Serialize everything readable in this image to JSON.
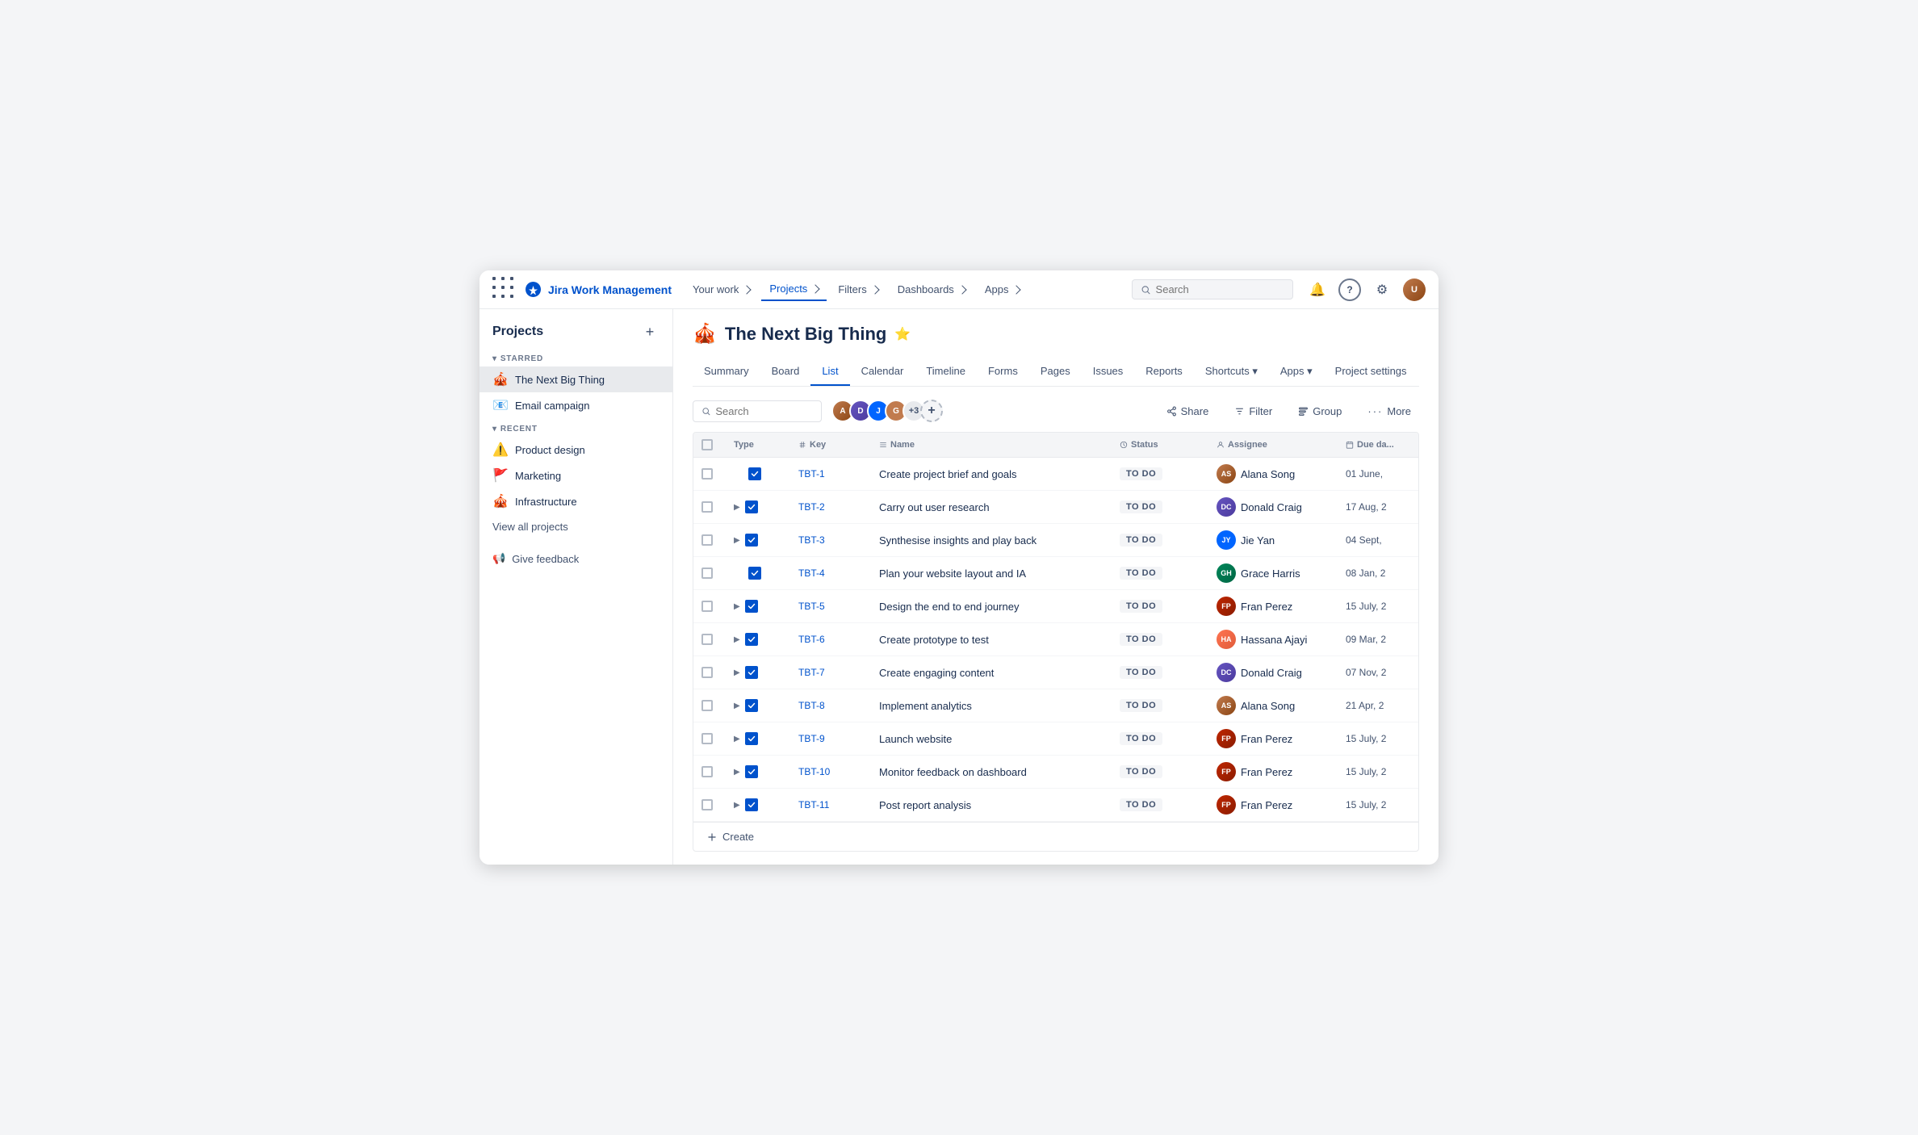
{
  "app": {
    "name": "Jira Work Management"
  },
  "nav": {
    "links": [
      {
        "id": "your-work",
        "label": "Your work",
        "active": false
      },
      {
        "id": "projects",
        "label": "Projects",
        "active": true
      },
      {
        "id": "filters",
        "label": "Filters",
        "active": false
      },
      {
        "id": "dashboards",
        "label": "Dashboards",
        "active": false
      },
      {
        "id": "apps",
        "label": "Apps",
        "active": false
      }
    ],
    "search_placeholder": "Search",
    "icons": {
      "notification": "🔔",
      "help": "?",
      "settings": "⚙"
    }
  },
  "sidebar": {
    "title": "Projects",
    "add_label": "+",
    "starred_label": "STARRED",
    "recent_label": "RECENT",
    "starred_items": [
      {
        "id": "next-big-thing",
        "emoji": "🎪",
        "label": "The Next Big Thing",
        "active": true
      },
      {
        "id": "email-campaign",
        "emoji": "📧",
        "label": "Email campaign",
        "active": false
      }
    ],
    "recent_items": [
      {
        "id": "product-design",
        "emoji": "⚠️",
        "label": "Product design",
        "active": false
      },
      {
        "id": "marketing",
        "emoji": "🚩",
        "label": "Marketing",
        "active": false
      },
      {
        "id": "infrastructure",
        "emoji": "🎪",
        "label": "Infrastructure",
        "active": false
      }
    ],
    "view_all": "View all projects",
    "feedback": "Give feedback"
  },
  "project": {
    "icon": "🎪",
    "name": "The Next Big Thing",
    "tabs": [
      {
        "id": "summary",
        "label": "Summary"
      },
      {
        "id": "board",
        "label": "Board"
      },
      {
        "id": "list",
        "label": "List",
        "active": true
      },
      {
        "id": "calendar",
        "label": "Calendar"
      },
      {
        "id": "timeline",
        "label": "Timeline"
      },
      {
        "id": "forms",
        "label": "Forms"
      },
      {
        "id": "pages",
        "label": "Pages"
      },
      {
        "id": "issues",
        "label": "Issues"
      },
      {
        "id": "reports",
        "label": "Reports"
      },
      {
        "id": "shortcuts",
        "label": "Shortcuts"
      },
      {
        "id": "apps",
        "label": "Apps"
      },
      {
        "id": "project-settings",
        "label": "Project settings"
      }
    ]
  },
  "toolbar": {
    "search_placeholder": "Search",
    "avatar_count": "+3",
    "share_label": "Share",
    "filter_label": "Filter",
    "group_label": "Group",
    "more_label": "More"
  },
  "table": {
    "columns": [
      "Type",
      "Key",
      "Name",
      "Status",
      "Assignee",
      "Due da..."
    ],
    "rows": [
      {
        "key": "TBT-1",
        "name": "Create project brief and goals",
        "status": "TO DO",
        "assignee": "Alana Song",
        "assignee_id": "alana",
        "due": "01 June,",
        "expand": false
      },
      {
        "key": "TBT-2",
        "name": "Carry out user research",
        "status": "TO DO",
        "assignee": "Donald Craig",
        "assignee_id": "donald",
        "due": "17 Aug, 2",
        "expand": true
      },
      {
        "key": "TBT-3",
        "name": "Synthesise insights and play back",
        "status": "TO DO",
        "assignee": "Jie Yan",
        "assignee_id": "jie",
        "due": "04 Sept,",
        "expand": true
      },
      {
        "key": "TBT-4",
        "name": "Plan your website layout and IA",
        "status": "TO DO",
        "assignee": "Grace Harris",
        "assignee_id": "grace",
        "due": "08 Jan, 2",
        "expand": false
      },
      {
        "key": "TBT-5",
        "name": "Design the end to end journey",
        "status": "TO DO",
        "assignee": "Fran Perez",
        "assignee_id": "fran",
        "due": "15 July, 2",
        "expand": true
      },
      {
        "key": "TBT-6",
        "name": "Create prototype to test",
        "status": "TO DO",
        "assignee": "Hassana Ajayi",
        "assignee_id": "hassana",
        "due": "09 Mar, 2",
        "expand": true
      },
      {
        "key": "TBT-7",
        "name": "Create engaging content",
        "status": "TO DO",
        "assignee": "Donald Craig",
        "assignee_id": "donald",
        "due": "07 Nov, 2",
        "expand": true
      },
      {
        "key": "TBT-8",
        "name": "Implement analytics",
        "status": "TO DO",
        "assignee": "Alana Song",
        "assignee_id": "alana",
        "due": "21 Apr, 2",
        "expand": true
      },
      {
        "key": "TBT-9",
        "name": "Launch website",
        "status": "TO DO",
        "assignee": "Fran Perez",
        "assignee_id": "fran",
        "due": "15 July, 2",
        "expand": true
      },
      {
        "key": "TBT-10",
        "name": "Monitor feedback on dashboard",
        "status": "TO DO",
        "assignee": "Fran Perez",
        "assignee_id": "fran",
        "due": "15 July, 2",
        "expand": true
      },
      {
        "key": "TBT-11",
        "name": "Post report analysis",
        "status": "TO DO",
        "assignee": "Fran Perez",
        "assignee_id": "fran",
        "due": "15 July, 2",
        "expand": true
      }
    ]
  },
  "create_label": "Create"
}
